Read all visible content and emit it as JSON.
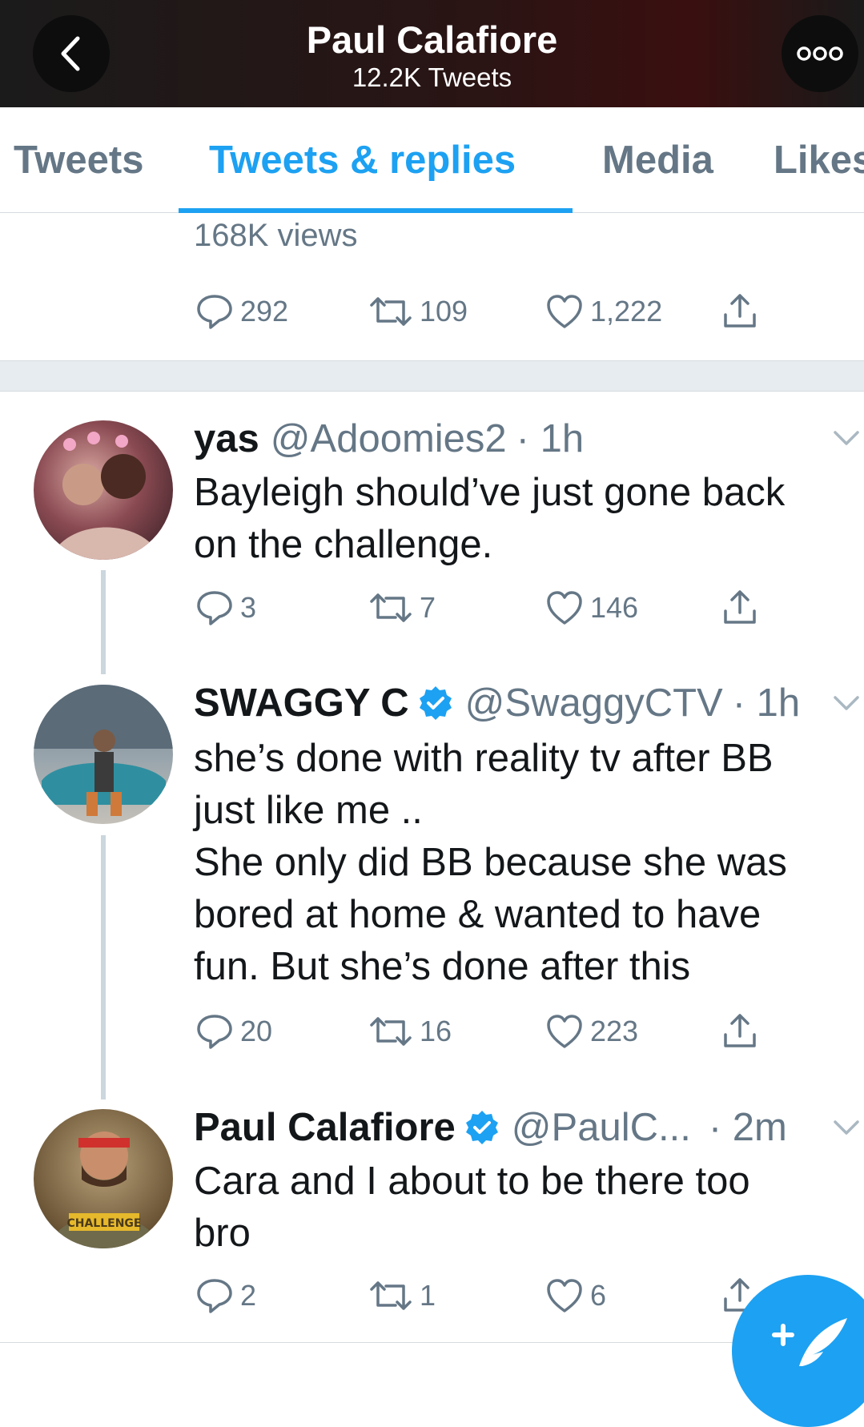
{
  "header": {
    "title": "Paul Calafiore",
    "subtitle": "12.2K Tweets",
    "back_icon": "chevron-left-icon",
    "more_icon": "more-icon"
  },
  "tabs": [
    {
      "label": "Tweets"
    },
    {
      "label": "Tweets & replies",
      "active": true
    },
    {
      "label": "Media"
    },
    {
      "label": "Likes"
    }
  ],
  "first_tweet": {
    "views": "168K views",
    "replies": "292",
    "retweets": "109",
    "likes": "1,222"
  },
  "tweets": [
    {
      "name": "yas",
      "handle": "@Adoomies2",
      "time": "· 1h",
      "verified": false,
      "text_lines": [
        "Bayleigh should’ve just gone back",
        "on the challenge."
      ],
      "replies": "3",
      "retweets": "7",
      "likes": "146"
    },
    {
      "name": "SWAGGY C",
      "handle": "@SwaggyCTV",
      "time": "· 1h",
      "verified": true,
      "text_lines": [
        "she’s done with reality tv after BB",
        "just like me ..",
        "She only did BB because she was",
        "bored at home & wanted to have",
        "fun. But she’s done after this"
      ],
      "replies": "20",
      "retweets": "16",
      "likes": "223"
    },
    {
      "name": "Paul Calafiore",
      "handle": "@PaulC...",
      "time": "· 2m",
      "verified": true,
      "text_lines": [
        "Cara and I about to be there too",
        "bro"
      ],
      "replies": "2",
      "retweets": "1",
      "likes": "6"
    }
  ],
  "avatar_shirt_text": "CHALLENGE",
  "colors": {
    "accent": "#1da1f2",
    "secondary_text": "#657786",
    "divider": "#e6ecf0"
  }
}
